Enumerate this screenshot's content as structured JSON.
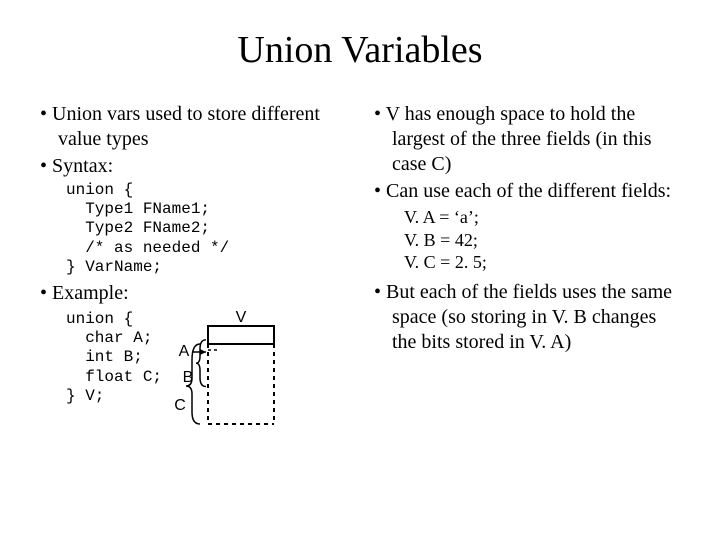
{
  "title": "Union Variables",
  "left": {
    "b1": "Union vars used to store different value types",
    "b2": "Syntax:",
    "code1": "union {\n  Type1 FName1;\n  Type2 FName2;\n  /* as needed */\n} VarName;",
    "b3": "Example:",
    "code2": "union {\n  char A;\n  int B;\n  float C;\n} V;"
  },
  "right": {
    "b1": "V has enough space to hold the largest of the three fields (in this case C)",
    "b2": "Can use each of the different fields:",
    "assign1": "V. A = ‘a’;",
    "assign2": "V. B = 42;",
    "assign3": "V. C = 2. 5;",
    "b3": "But each of the fields uses the same space (so storing in V. B changes the bits stored in V. A)"
  },
  "diagram": {
    "V": "V",
    "A": "A",
    "B": "B",
    "C": "C"
  }
}
